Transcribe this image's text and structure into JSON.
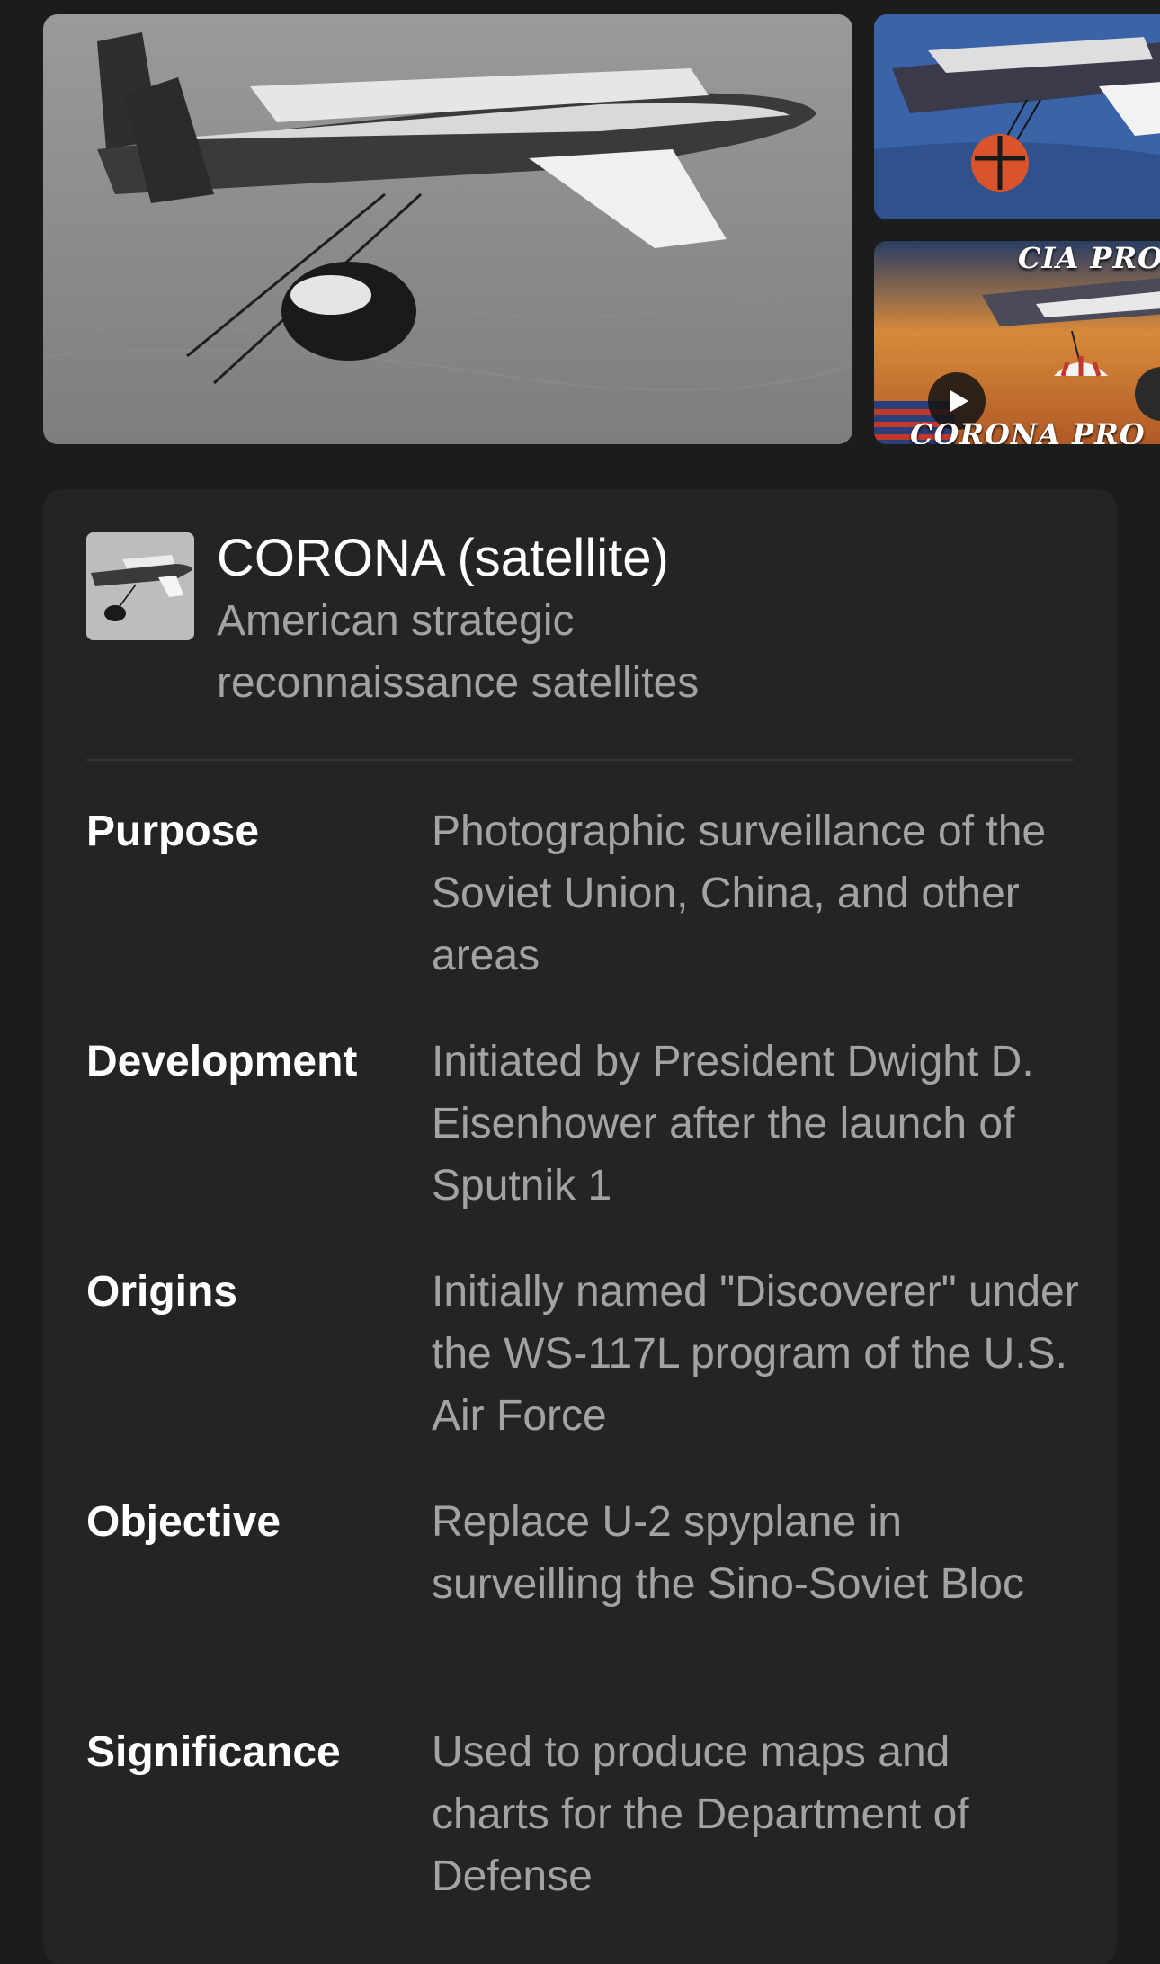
{
  "gallery": {
    "images": [
      {
        "name": "main-photo-aircraft-capsule-recovery"
      },
      {
        "name": "side-photo-aircraft-color"
      },
      {
        "name": "side-video-thumbnail",
        "has_play_icon": true
      }
    ],
    "video_overlay_top": "CIA PROC",
    "video_overlay_bottom": "CORONA PRO"
  },
  "card": {
    "title": "CORONA (satellite)",
    "subtitle": "American strategic reconnaissance satellites",
    "facts": [
      {
        "label": "Purpose",
        "value": "Photographic surveillance of the Soviet Union, China, and other areas"
      },
      {
        "label": "Development",
        "value": "Initiated by President Dwight D. Eisenhower after the launch of Sputnik 1"
      },
      {
        "label": "Origins",
        "value": "Initially named \"Discoverer\" under the WS-117L program of the U.S. Air Force"
      },
      {
        "label": "Objective",
        "value": "Replace U-2 spyplane in surveilling the Sino-Soviet Bloc"
      },
      {
        "label": "Significance",
        "value": "Used to produce maps and charts for the Department of Defense"
      }
    ]
  },
  "colors": {
    "background": "#1b1c1c",
    "card": "#232424",
    "title": "#ffffff",
    "secondary_text": "#a3a3a3"
  }
}
